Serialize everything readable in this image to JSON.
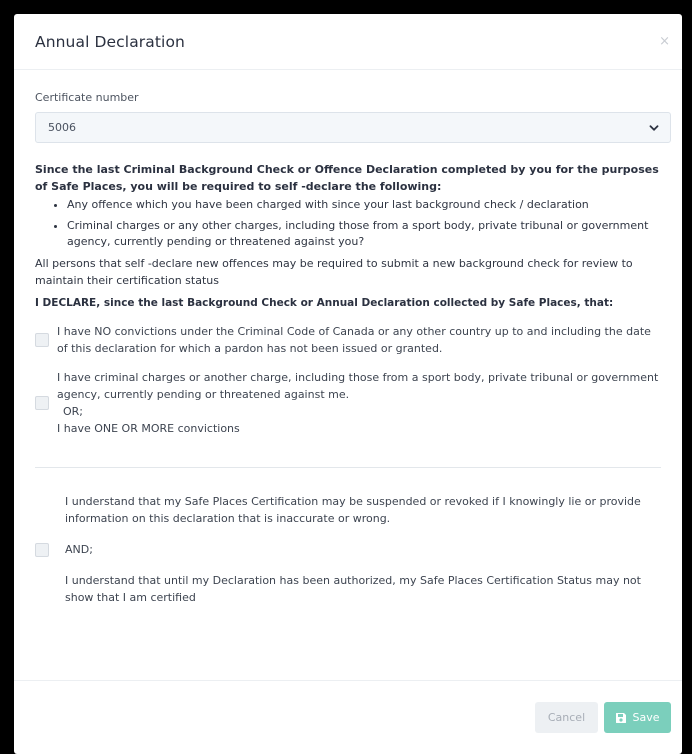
{
  "dialog": {
    "title": "Annual Declaration",
    "close": "×"
  },
  "certificate": {
    "label": "Certificate number",
    "value": "5006"
  },
  "intro": "Since the last Criminal Background Check or Offence Declaration completed by you for the purposes of Safe Places, you will be required to self -declare the following:",
  "bullets": [
    "Any offence which you have been charged with since your last background check / declaration",
    "Criminal charges or any other charges, including those from a sport body, private tribunal or government agency, currently pending or threatened against you?"
  ],
  "note": "All persons that self -declare new offences may be required to submit a new background check for review to maintain their certification status",
  "declare_heading": "I DECLARE, since the last Background Check or Annual Declaration collected by Safe Places, that:",
  "options": {
    "no_convictions": "I have NO convictions under the Criminal Code of Canada or any other country up to and including the date of this declaration for which a pardon has not been issued or granted.",
    "charges": "I have criminal charges or another charge, including those from a sport body, private tribunal or government agency, currently pending or threatened against me.",
    "or": "OR;",
    "convictions": "I have ONE OR MORE convictions"
  },
  "acknowledgement": {
    "p1": "I understand that my Safe Places Certification may be suspended or revoked if I knowingly lie or provide information on this declaration that is inaccurate or wrong.",
    "and": "AND;",
    "p2": "I understand that until my Declaration has been authorized, my Safe Places Certification Status may not show that I am certified"
  },
  "footer": {
    "cancel": "Cancel",
    "save": "Save"
  },
  "colors": {
    "save_button": "#7bcfbc",
    "cancel_button": "#edf0f3"
  },
  "icons": {
    "close": "close-icon",
    "select_arrow": "chevron-down-icon",
    "save": "floppy-disk-icon"
  }
}
